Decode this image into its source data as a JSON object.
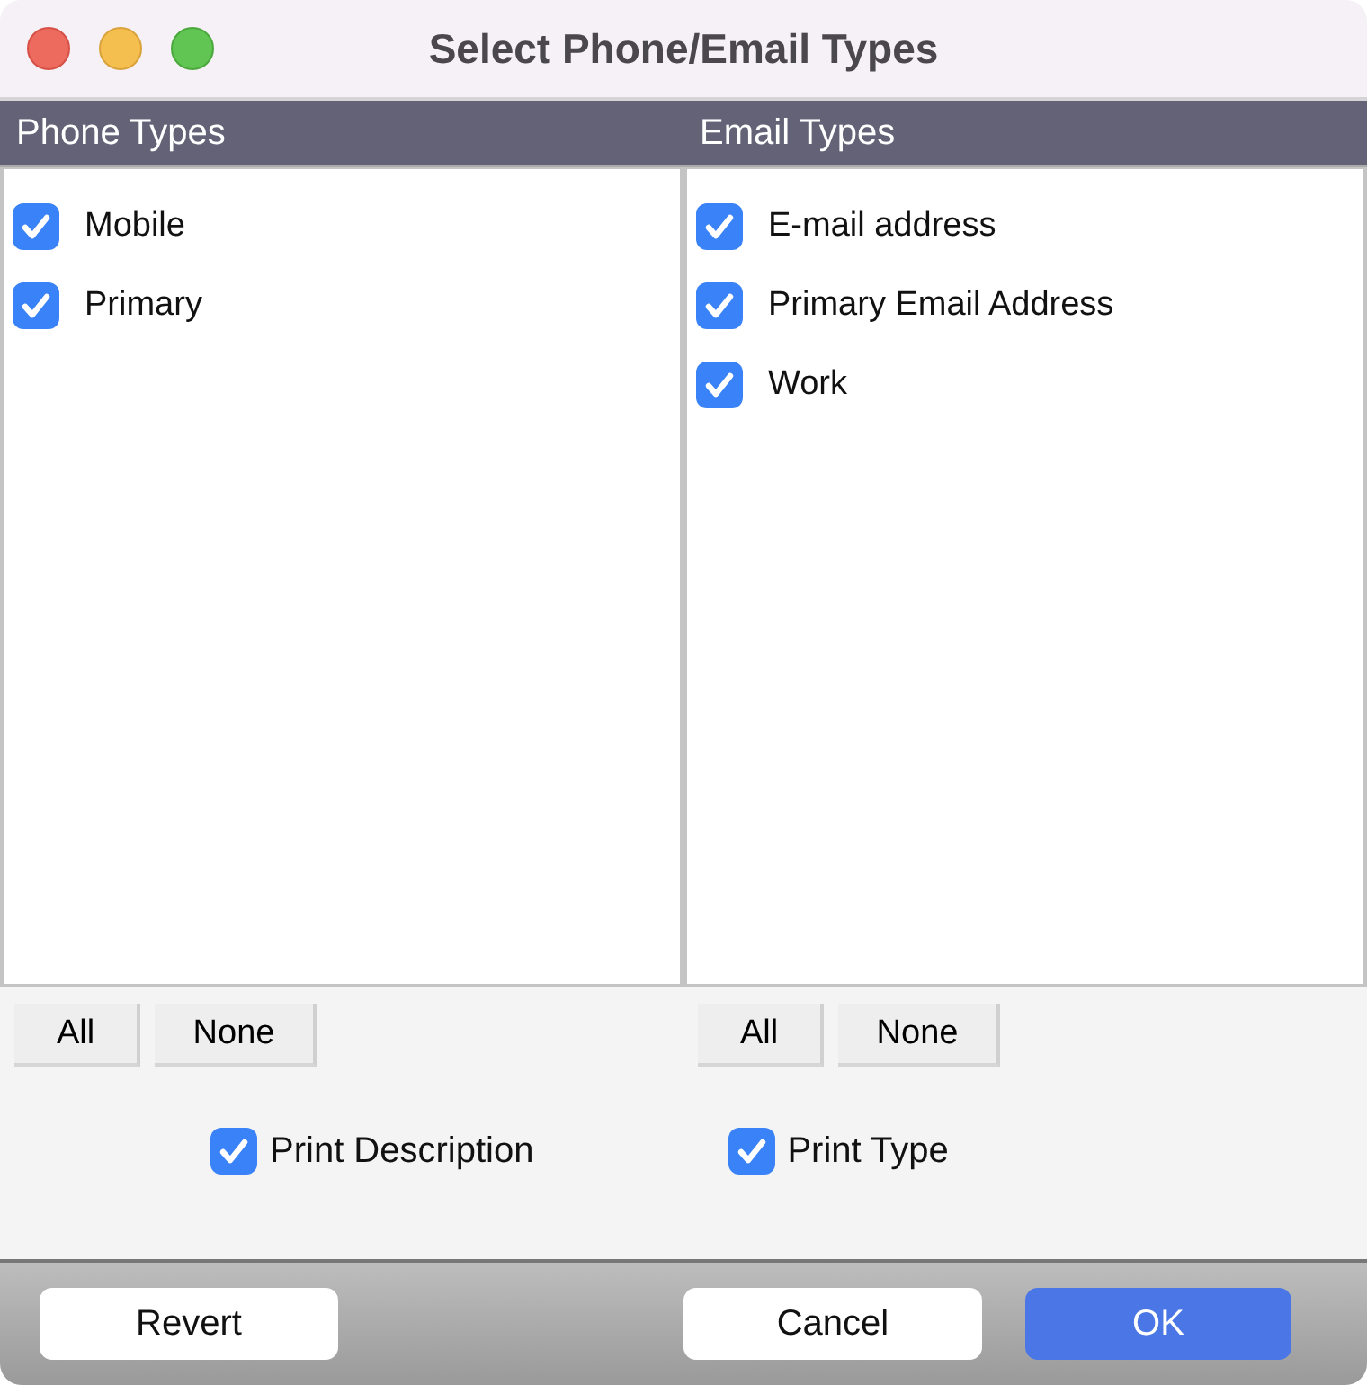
{
  "window": {
    "title": "Select Phone/Email Types"
  },
  "columns": [
    {
      "title": "Phone Types",
      "items": [
        {
          "label": "Mobile",
          "checked": true
        },
        {
          "label": "Primary",
          "checked": true
        }
      ],
      "buttons": [
        "All",
        "None"
      ]
    },
    {
      "title": "Email Types",
      "items": [
        {
          "label": "E-mail address",
          "checked": true
        },
        {
          "label": "Primary Email Address",
          "checked": true
        },
        {
          "label": "Work",
          "checked": true
        }
      ],
      "buttons": [
        "All",
        "None"
      ]
    }
  ],
  "options": [
    {
      "label": "Print Description",
      "checked": true
    },
    {
      "label": "Print Type",
      "checked": true
    }
  ],
  "footer_buttons": [
    {
      "label": "Revert",
      "kind": "normal"
    },
    {
      "label": "Cancel",
      "kind": "normal"
    },
    {
      "label": "OK",
      "kind": "primary"
    }
  ]
}
